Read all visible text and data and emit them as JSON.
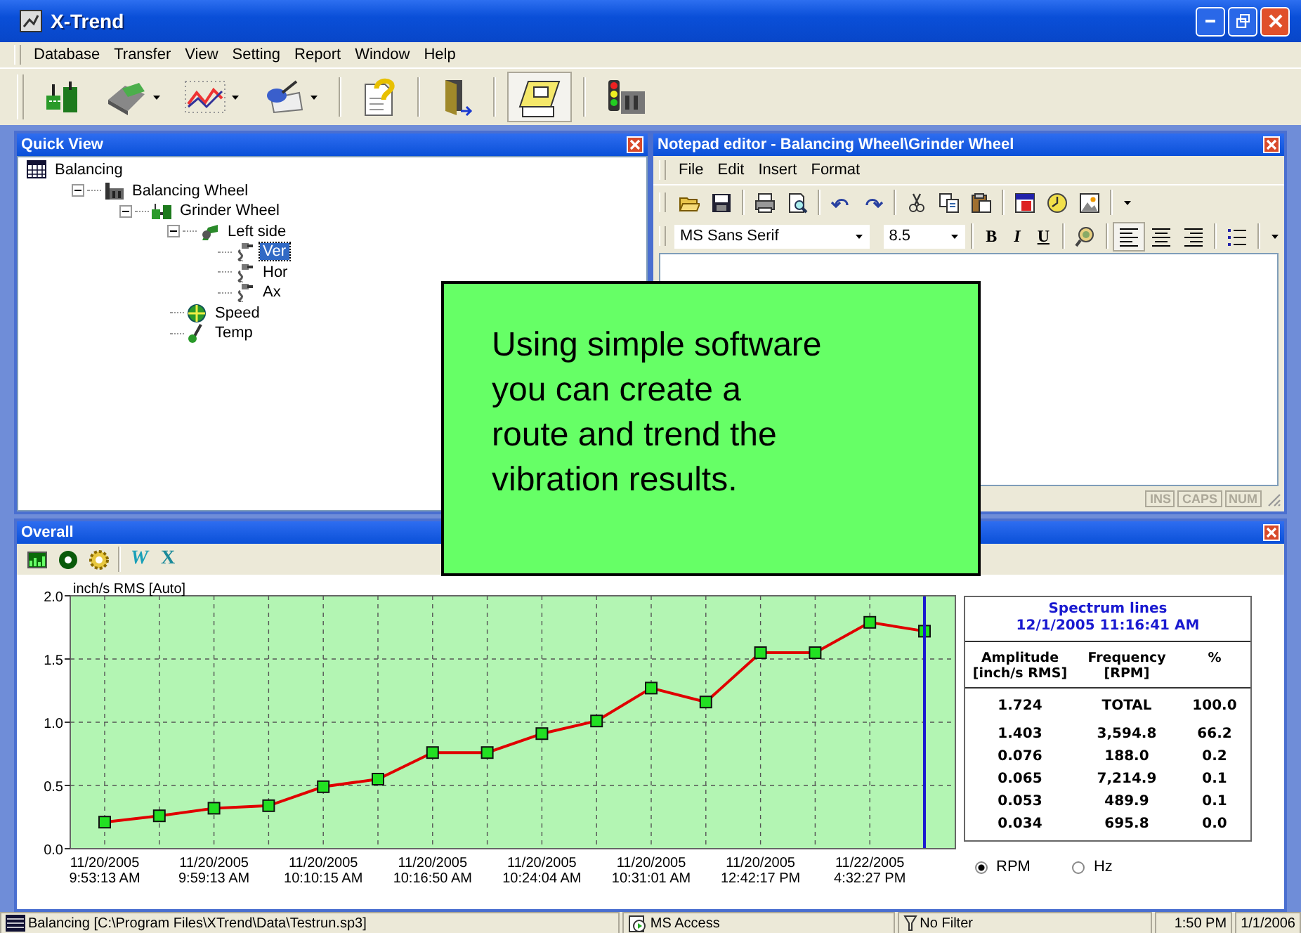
{
  "window": {
    "title": "X-Trend"
  },
  "menu": [
    "Database",
    "Transfer",
    "View",
    "Setting",
    "Report",
    "Window",
    "Help"
  ],
  "quick_view": {
    "title": "Quick View",
    "tree": [
      {
        "label": "Balancing",
        "kind": "database",
        "selected": false,
        "children": [
          {
            "label": "Balancing Wheel",
            "kind": "plant",
            "selected": false,
            "expanded": true,
            "children": [
              {
                "label": "Grinder Wheel",
                "kind": "machine",
                "selected": false,
                "expanded": true,
                "children": [
                  {
                    "label": "Left side",
                    "kind": "component",
                    "selected": false,
                    "expanded": true,
                    "children": [
                      {
                        "label": "Ver",
                        "kind": "sensor",
                        "selected": true
                      },
                      {
                        "label": "Hor",
                        "kind": "sensor",
                        "selected": false
                      },
                      {
                        "label": "Ax",
                        "kind": "sensor",
                        "selected": false
                      }
                    ]
                  },
                  {
                    "label": "Speed",
                    "kind": "tachometer",
                    "selected": false
                  },
                  {
                    "label": "Temp",
                    "kind": "thermometer",
                    "selected": false
                  }
                ]
              }
            ]
          }
        ]
      }
    ]
  },
  "notepad": {
    "title": "Notepad editor - Balancing Wheel\\Grinder Wheel",
    "menu": [
      "File",
      "Edit",
      "Insert",
      "Format"
    ],
    "font": "MS Sans Serif",
    "size": "8.5",
    "format_buttons": [
      "B",
      "I",
      "U"
    ],
    "indicators": [
      {
        "label": "INS",
        "on": false
      },
      {
        "label": "CAPS",
        "on": false
      },
      {
        "label": "NUM",
        "on": false
      }
    ]
  },
  "overall": {
    "title": "Overall",
    "export_buttons": [
      "W",
      "X"
    ],
    "chart_data": {
      "type": "line",
      "ylabel": "inch/s  RMS  [Auto]",
      "categories": [
        "11/20/2005\n9:53:13 AM",
        null,
        "11/20/2005\n9:59:13 AM",
        null,
        "11/20/2005\n10:10:15 AM",
        null,
        "11/20/2005\n10:16:50 AM",
        null,
        "11/20/2005\n10:24:04 AM",
        null,
        "11/20/2005\n10:31:01 AM",
        null,
        "11/20/2005\n12:42:17 PM",
        null,
        "11/22/2005\n4:32:27 PM",
        null
      ],
      "grid": true,
      "series": [
        {
          "color": "#e00000",
          "marker": "square",
          "values": [
            0.21,
            0.26,
            0.32,
            0.34,
            0.49,
            0.55,
            0.76,
            0.76,
            0.91,
            1.01,
            1.27,
            1.16,
            1.55,
            1.55,
            1.79,
            1.72
          ]
        }
      ],
      "ylim": [
        0,
        2
      ],
      "yticks": [
        {
          "value": 0,
          "label": "0.0"
        },
        {
          "value": 0.5,
          "label": "0.5"
        },
        {
          "value": 1,
          "label": "1.0"
        },
        {
          "value": 1.5,
          "label": "1.5"
        },
        {
          "value": 2,
          "label": "2.0"
        }
      ]
    },
    "spectrum": {
      "title": "Spectrum lines",
      "timestamp": "12/1/2005 11:16:41 AM",
      "columns": [
        "Amplitude\n[inch/s RMS]",
        "Frequency\n[RPM]",
        "%"
      ],
      "total": [
        "1.724",
        "TOTAL",
        "100.0"
      ],
      "rows": [
        [
          "1.403",
          "3,594.8",
          "66.2"
        ],
        [
          "0.076",
          "188.0",
          "0.2"
        ],
        [
          "0.065",
          "7,214.9",
          "0.1"
        ],
        [
          "0.053",
          "489.9",
          "0.1"
        ],
        [
          "0.034",
          "695.8",
          "0.0"
        ]
      ]
    },
    "units": [
      {
        "label": "RPM",
        "selected": true
      },
      {
        "label": "Hz",
        "selected": false
      }
    ]
  },
  "callout": {
    "text": "Using simple software\nyou can create a\nroute and trend the\nvibration results."
  },
  "status_bar": [
    "Balancing [C:\\Program Files\\XTrend\\Data\\Testrun.sp3]",
    "MS Access",
    "No Filter",
    "1:50 PM",
    "1/1/2006"
  ]
}
